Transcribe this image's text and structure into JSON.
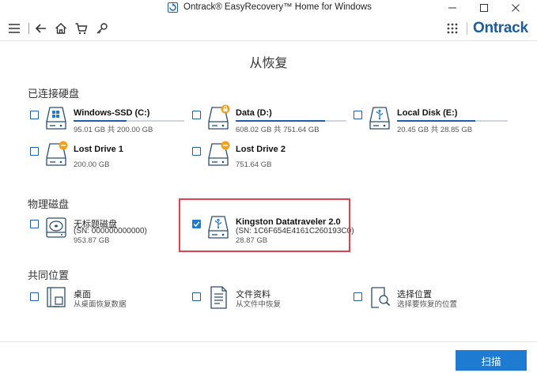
{
  "window": {
    "title": "Ontrack® EasyRecovery™ Home for Windows"
  },
  "toolbar": {
    "brand": "Ontrack"
  },
  "page": {
    "title": "从恢复"
  },
  "sections": {
    "connected": "已连接硬盘",
    "physical": "物理磁盘",
    "common": "共同位置"
  },
  "connected_drives": [
    {
      "name": "Windows-SSD (C:)",
      "size": "95.01 GB 共 200.00 GB",
      "used_fraction": 0.475,
      "icon": "windows-drive-icon"
    },
    {
      "name": "Data (D:)",
      "size": "608.02 GB 共 751.64 GB",
      "used_fraction": 0.809,
      "icon": "locked-drive-icon"
    },
    {
      "name": "Local Disk (E:)",
      "size": "20.45 GB 共 28.85 GB",
      "used_fraction": 0.709,
      "icon": "usb-drive-icon"
    },
    {
      "name": "Lost Drive 1",
      "size": "200.00 GB",
      "icon": "lost-drive-icon"
    },
    {
      "name": "Lost Drive 2",
      "size": "751.64 GB",
      "icon": "lost-drive-icon"
    }
  ],
  "physical_disks": [
    {
      "name": "无标题磁盘",
      "serial": "(SN: 000000000000)",
      "size": "953.87 GB",
      "checked": false,
      "icon": "hard-disk-icon"
    },
    {
      "name": "Kingston Datatraveler 2.0",
      "serial": "(SN: 1C6F654E4161C260193C0)",
      "size": "28.87 GB",
      "checked": true,
      "icon": "usb-drive-icon"
    }
  ],
  "common_locations": [
    {
      "name": "桌面",
      "desc": "从桌面恢复数据",
      "icon": "desktop-icon"
    },
    {
      "name": "文件资料",
      "desc": "从文件中恢复",
      "icon": "documents-icon"
    },
    {
      "name": "选择位置",
      "desc": "选择要恢复的位置",
      "icon": "choose-location-icon"
    }
  ],
  "footer": {
    "scan_label": "扫描"
  },
  "colors": {
    "accent": "#1f7bd1",
    "brand": "#1a5c9e",
    "highlight": "#e0414f",
    "warning": "#f3a01a"
  }
}
